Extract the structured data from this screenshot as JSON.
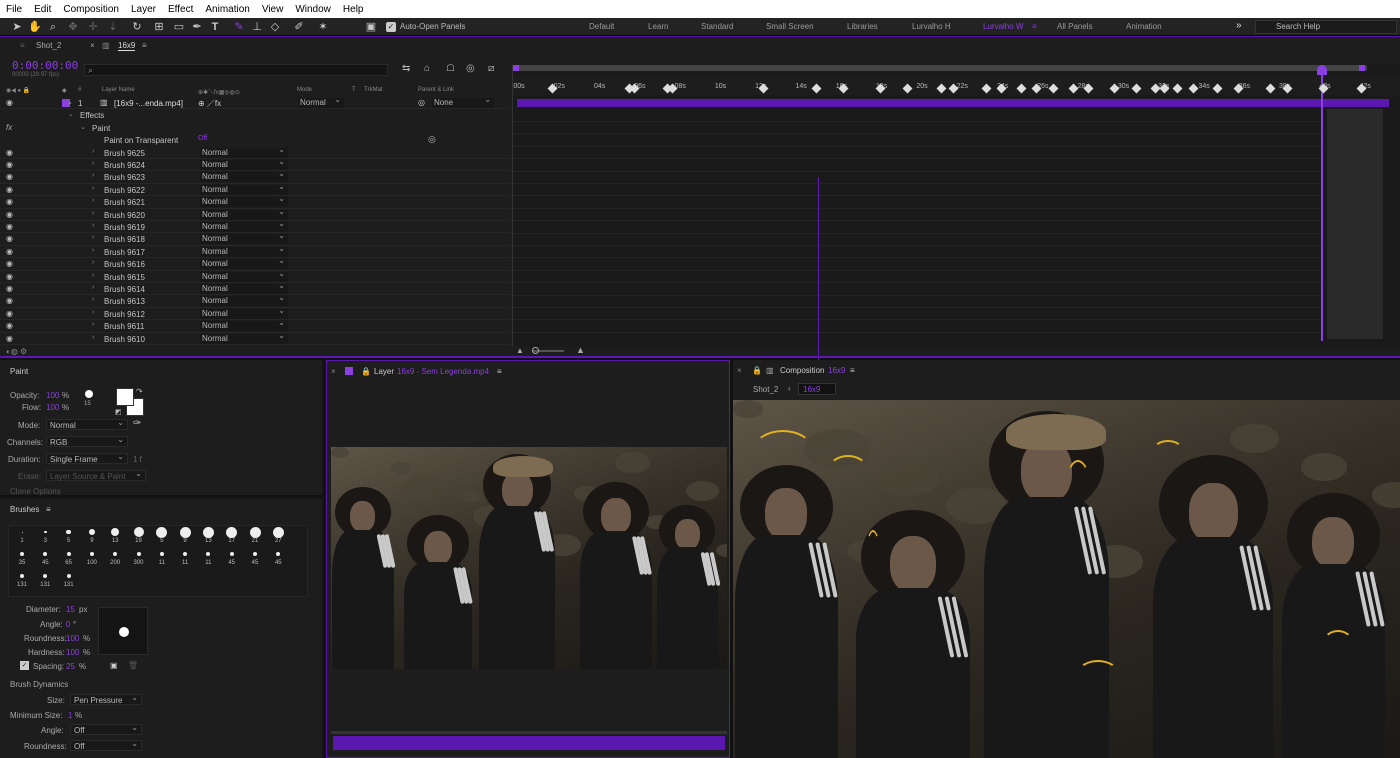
{
  "menu": [
    "File",
    "Edit",
    "Composition",
    "Layer",
    "Effect",
    "Animation",
    "View",
    "Window",
    "Help"
  ],
  "toolbar": {
    "auto_open": "Auto-Open Panels",
    "workspaces": [
      "Default",
      "Learn",
      "Standard",
      "Small Screen",
      "Libraries",
      "Lurvalho H",
      "Lurvalho W",
      "All Panels",
      "Animation"
    ],
    "active_workspace": "Lurvalho W",
    "search": "Search Help"
  },
  "timeline": {
    "tabs": [
      "Shot_2",
      "16x9"
    ],
    "timecode": "0:00:00:00",
    "fps": "00000 (29.97 fps)",
    "headers": {
      "layer_name": "Layer Name",
      "mode": "Mode",
      "t": "T",
      "trkmat": "TrkMat",
      "parent": "Parent & Link"
    },
    "layer": {
      "num": "1",
      "name": "[16x9 -...enda.mp4]",
      "mode": "Normal",
      "parent": "None"
    },
    "effects": "Effects",
    "paint": "Paint",
    "paint_on_transparent": "Paint on Transparent",
    "paint_on_transparent_val": "Off",
    "brushes": [
      "Brush 9625",
      "Brush 9624",
      "Brush 9623",
      "Brush 9622",
      "Brush 9621",
      "Brush 9620",
      "Brush 9619",
      "Brush 9618",
      "Brush 9617",
      "Brush 9616",
      "Brush 9615",
      "Brush 9614",
      "Brush 9613",
      "Brush 9612",
      "Brush 9611",
      "Brush 9610"
    ],
    "brush_mode": "Normal",
    "ticks": [
      "00s",
      "02s",
      "04s",
      "06s",
      "08s",
      "10s",
      "12s",
      "14s",
      "16s",
      "18s",
      "20s",
      "22s",
      "24s",
      "26s",
      "28s",
      "30s",
      "32s",
      "34s",
      "36s",
      "38s",
      "40s",
      "42s"
    ]
  },
  "paint_panel": {
    "title": "Paint",
    "opacity_label": "Opacity:",
    "opacity": "100",
    "pct": "%",
    "flow_label": "Flow:",
    "flow": "100",
    "brush_size": "15",
    "mode_label": "Mode:",
    "mode": "Normal",
    "channels_label": "Channels:",
    "channels": "RGB",
    "duration_label": "Duration:",
    "duration": "Single Frame",
    "duration_frames": "1 f",
    "erase_label": "Erase:",
    "erase": "Layer Source & Paint",
    "clone_options": "Clone Options"
  },
  "brushes_panel": {
    "title": "Brushes",
    "row1": [
      "1",
      "3",
      "5",
      "9",
      "13",
      "19",
      "5",
      "9",
      "13",
      "17",
      "21",
      "27"
    ],
    "row2": [
      "35",
      "45",
      "65",
      "100",
      "200",
      "300",
      "11",
      "11",
      "11",
      "45",
      "45",
      "45"
    ],
    "row3": [
      "131",
      "131",
      "131"
    ],
    "diameter_label": "Diameter:",
    "diameter": "15",
    "px": "px",
    "angle_label": "Angle:",
    "angle": "0",
    "deg": "°",
    "roundness_label": "Roundness:",
    "roundness": "100",
    "hardness_label": "Hardness:",
    "hardness": "100",
    "spacing_label": "Spacing:",
    "spacing": "25",
    "dynamics": "Brush Dynamics",
    "size_label": "Size:",
    "size": "Pen Pressure",
    "minsize_label": "Minimum Size:",
    "minsize": "1",
    "dangle_label": "Angle:",
    "dangle": "Off",
    "droundness_label": "Roundness:",
    "droundness": "Off"
  },
  "layer_panel": {
    "label": "Layer",
    "source": "16x9 - Sem Legenda.mp4"
  },
  "comp_panel": {
    "label": "Composition",
    "name": "16x9",
    "crumbs": [
      "Shot_2",
      "16x9"
    ]
  },
  "colors": {
    "accent": "#8a3fe0",
    "bar": "#5b18b0",
    "paint": "#e0b020"
  }
}
